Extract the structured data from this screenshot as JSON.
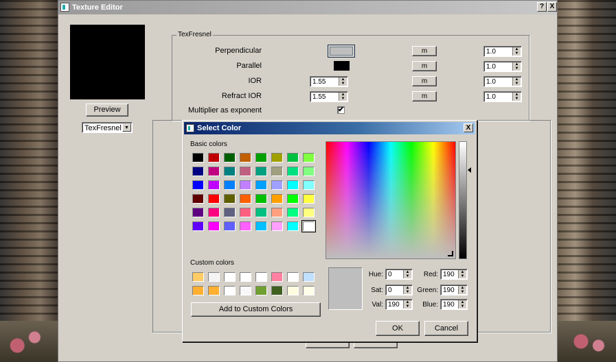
{
  "editor": {
    "title": "Texture Editor",
    "help_label": "?",
    "close_label": "X",
    "preview_button": "Preview",
    "texture_select": "TexFresnel",
    "group_title": "TexFresnel",
    "rows": [
      {
        "label": "Perpendicular",
        "swatch_color": "#bebebe",
        "map_label": "m",
        "value": "1.0"
      },
      {
        "label": "Parallel",
        "swatch_color": "#000000",
        "map_label": "m",
        "value": "1.0"
      },
      {
        "label": "IOR",
        "input_value": "1.55",
        "map_label": "m",
        "value": "1.0"
      },
      {
        "label": "Refract IOR",
        "input_value": "1.55",
        "map_label": "m",
        "value": "1.0"
      }
    ],
    "multiplier": {
      "label": "Multiplier as exponent",
      "checked": "✔"
    }
  },
  "dialog": {
    "title": "Select Color",
    "close_label": "X",
    "basic_colors_label": "Basic colors",
    "basic_colors": [
      [
        "#000000",
        "#c00000",
        "#006000",
        "#c06000",
        "#00a000",
        "#a0a000",
        "#00c040",
        "#80ff40"
      ],
      [
        "#000080",
        "#c00080",
        "#008080",
        "#c06080",
        "#00a080",
        "#a0a080",
        "#00e080",
        "#80ff80"
      ],
      [
        "#0000ff",
        "#c000ff",
        "#0080ff",
        "#c080ff",
        "#00a0ff",
        "#a0a0ff",
        "#00ffff",
        "#80ffff"
      ],
      [
        "#600000",
        "#ff0000",
        "#606000",
        "#ff6000",
        "#00c000",
        "#ffa000",
        "#00ff00",
        "#ffff40"
      ],
      [
        "#600080",
        "#ff0080",
        "#606080",
        "#ff6080",
        "#00c080",
        "#ffa080",
        "#00ff80",
        "#ffff80"
      ],
      [
        "#6000ff",
        "#ff00ff",
        "#6060ff",
        "#ff60ff",
        "#00c0ff",
        "#ffa0ff",
        "#00ffff",
        "#ffffff"
      ]
    ],
    "custom_colors_label": "Custom colors",
    "custom_colors": [
      [
        "#ffcc66",
        "#f4f4f4",
        "#ffffff",
        "#ffffff",
        "#ffffff",
        "#ff80a0",
        "#ffffff",
        "#c0e0ff"
      ],
      [
        "#ffb030",
        "#ffb030",
        "#ffffff",
        "#f8f8f8",
        "#70a030",
        "#406020",
        "#fffce0",
        "#ffffe8"
      ]
    ],
    "add_custom_label": "Add to Custom Colors",
    "current_color": "#bebebe",
    "fields": {
      "hue_label": "Hue:",
      "hue": "0",
      "sat_label": "Sat:",
      "sat": "0",
      "val_label": "Val:",
      "val": "190",
      "red_label": "Red:",
      "red": "190",
      "green_label": "Green:",
      "green": "190",
      "blue_label": "Blue:",
      "blue": "190"
    },
    "ok_label": "OK",
    "cancel_label": "Cancel"
  }
}
